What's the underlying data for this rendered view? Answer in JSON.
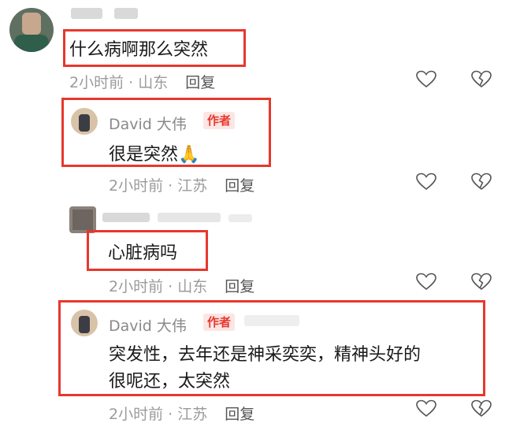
{
  "comments": [
    {
      "text": "什么病啊那么突然",
      "meta": "2小时前 · 山东",
      "reply": "回复"
    },
    {
      "author": "David 大伟",
      "badge": "作者",
      "text": "很是突然",
      "emoji": "🙏",
      "meta": "2小时前 · 江苏",
      "reply": "回复"
    },
    {
      "text": "心脏病吗",
      "meta": "2小时前 · 山东",
      "reply": "回复"
    },
    {
      "author": "David 大伟",
      "badge": "作者",
      "text_line1": "突发性，去年还是神采奕奕，精神头好的",
      "text_line2": "很呢还，太突然",
      "meta": "2小时前 · 江苏",
      "reply": "回复"
    }
  ],
  "colors": {
    "highlight": "#e8372d",
    "meta_text": "#9b9b9b",
    "badge_bg": "#fce6e4"
  },
  "icons": [
    "heart-outline-icon",
    "broken-heart-icon"
  ]
}
